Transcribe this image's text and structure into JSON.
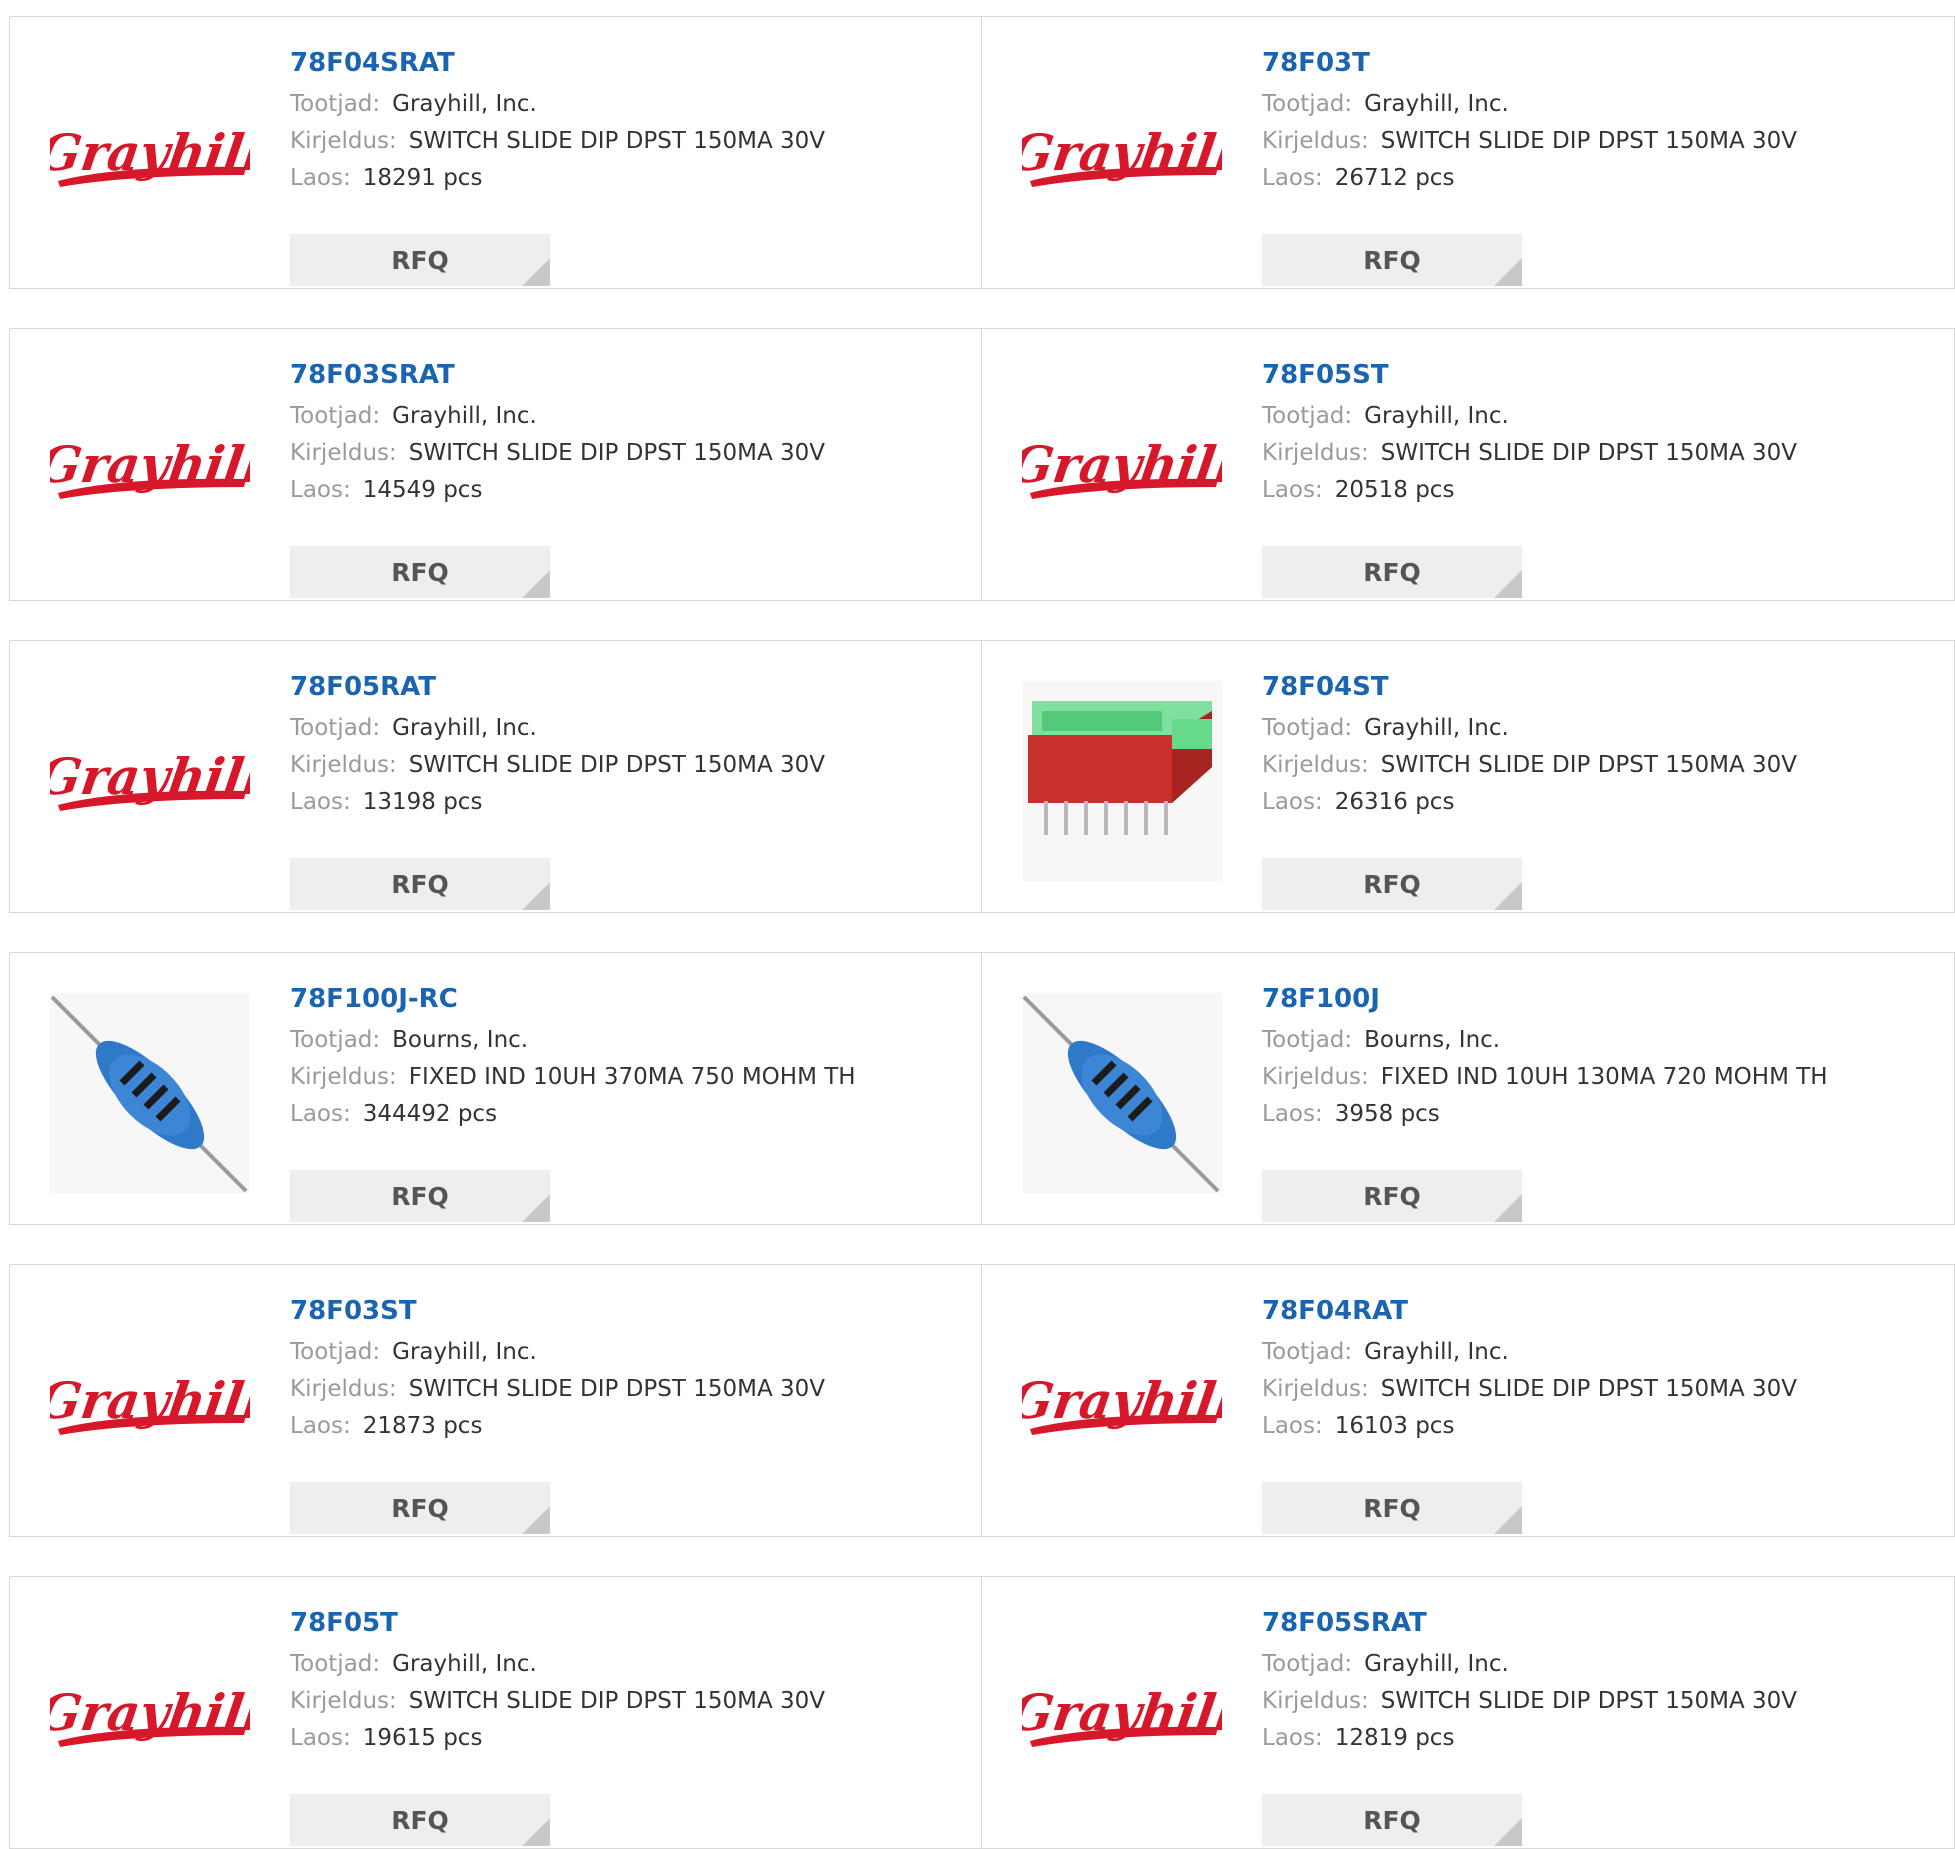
{
  "labels": {
    "manufacturer": "Tootjad:",
    "description": "Kirjeldus:",
    "stock": "Laos:",
    "rfq": "RFQ"
  },
  "colors": {
    "link": "#1a64b0",
    "label": "#9a9a9a",
    "brand_red": "#d7182a"
  },
  "products": [
    {
      "part": "78F04SRAT",
      "manufacturer": "Grayhill, Inc.",
      "description": "SWITCH SLIDE DIP DPST 150MA 30V",
      "stock": "18291 pcs",
      "image": "grayhill-logo",
      "logo_text": "Grayhill"
    },
    {
      "part": "78F03T",
      "manufacturer": "Grayhill, Inc.",
      "description": "SWITCH SLIDE DIP DPST 150MA 30V",
      "stock": "26712 pcs",
      "image": "grayhill-logo",
      "logo_text": "Grayhill"
    },
    {
      "part": "78F03SRAT",
      "manufacturer": "Grayhill, Inc.",
      "description": "SWITCH SLIDE DIP DPST 150MA 30V",
      "stock": "14549 pcs",
      "image": "grayhill-logo",
      "logo_text": "Grayhill"
    },
    {
      "part": "78F05ST",
      "manufacturer": "Grayhill, Inc.",
      "description": "SWITCH SLIDE DIP DPST 150MA 30V",
      "stock": "20518 pcs",
      "image": "grayhill-logo",
      "logo_text": "Grayhill"
    },
    {
      "part": "78F05RAT",
      "manufacturer": "Grayhill, Inc.",
      "description": "SWITCH SLIDE DIP DPST 150MA 30V",
      "stock": "13198 pcs",
      "image": "grayhill-logo",
      "logo_text": "Grayhill"
    },
    {
      "part": "78F04ST",
      "manufacturer": "Grayhill, Inc.",
      "description": "SWITCH SLIDE DIP DPST 150MA 30V",
      "stock": "26316 pcs",
      "image": "dip-switch-photo"
    },
    {
      "part": "78F100J-RC",
      "manufacturer": "Bourns, Inc.",
      "description": "FIXED IND 10UH 370MA 750 MOHM TH",
      "stock": "344492 pcs",
      "image": "inductor-photo"
    },
    {
      "part": "78F100J",
      "manufacturer": "Bourns, Inc.",
      "description": "FIXED IND 10UH 130MA 720 MOHM TH",
      "stock": "3958 pcs",
      "image": "inductor-photo"
    },
    {
      "part": "78F03ST",
      "manufacturer": "Grayhill, Inc.",
      "description": "SWITCH SLIDE DIP DPST 150MA 30V",
      "stock": "21873 pcs",
      "image": "grayhill-logo",
      "logo_text": "Grayhill"
    },
    {
      "part": "78F04RAT",
      "manufacturer": "Grayhill, Inc.",
      "description": "SWITCH SLIDE DIP DPST 150MA 30V",
      "stock": "16103 pcs",
      "image": "grayhill-logo",
      "logo_text": "Grayhill"
    },
    {
      "part": "78F05T",
      "manufacturer": "Grayhill, Inc.",
      "description": "SWITCH SLIDE DIP DPST 150MA 30V",
      "stock": "19615 pcs",
      "image": "grayhill-logo",
      "logo_text": "Grayhill"
    },
    {
      "part": "78F05SRAT",
      "manufacturer": "Grayhill, Inc.",
      "description": "SWITCH SLIDE DIP DPST 150MA 30V",
      "stock": "12819 pcs",
      "image": "grayhill-logo",
      "logo_text": "Grayhill"
    }
  ]
}
